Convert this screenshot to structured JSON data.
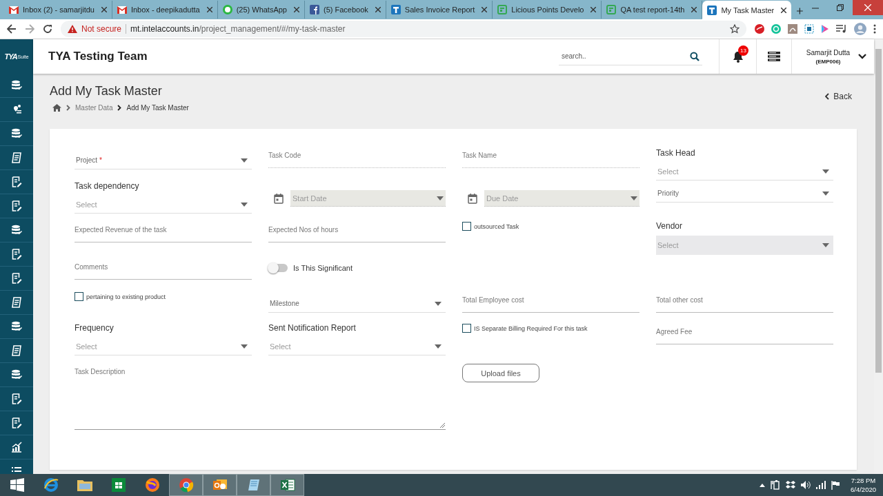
{
  "browser": {
    "tabs": [
      {
        "title": "Inbox (2) - samarjitdu",
        "kind": "mail",
        "selected": false
      },
      {
        "title": "Inbox - deepikadutta",
        "kind": "mail",
        "selected": false
      },
      {
        "title": "(25) WhatsApp",
        "kind": "chat",
        "selected": false
      },
      {
        "title": "(5) Facebook",
        "kind": "social",
        "selected": false
      },
      {
        "title": "Sales Invoice Report",
        "kind": "app",
        "selected": false
      },
      {
        "title": "Licious Points Develo",
        "kind": "sheet",
        "selected": false
      },
      {
        "title": "QA test report-14th",
        "kind": "sheet",
        "selected": false
      },
      {
        "title": "My Task Master",
        "kind": "app",
        "selected": true
      }
    ],
    "security": "Not secure",
    "url_host": "mt.intelaccounts.in",
    "url_path": "/project_management/#/my-task-master"
  },
  "header": {
    "logo": "TYA",
    "logo_sub": "Suite",
    "team": "TYA Testing Team",
    "search": {
      "placeholder": "search.."
    },
    "notifications": "13",
    "user": {
      "name": "Samarjit Dutta",
      "code": "(EMP006)"
    }
  },
  "page": {
    "title": "Add My Task Master",
    "breadcrumb": [
      {
        "label": "Master Data",
        "current": false
      },
      {
        "label": "Add My Task Master",
        "current": true
      }
    ],
    "back": "Back"
  },
  "form": {
    "rows": [
      {
        "fields": [
          {
            "kind": "select",
            "label": "Project",
            "required_mark": "*"
          },
          {
            "kind": "dotted",
            "label": "Task Code"
          },
          {
            "kind": "dotted",
            "label": "Task Name"
          },
          {
            "kind": "labeled-select",
            "label": "Task Head",
            "placeholder": "Select",
            "disabled": false
          }
        ]
      },
      {
        "fields": [
          {
            "kind": "labeled-select",
            "label": "Task dependency",
            "placeholder": "Select",
            "disabled": false
          },
          {
            "kind": "date",
            "label": "Start Date",
            "disabled": true
          },
          {
            "kind": "date",
            "label": "Due Date",
            "disabled": true
          },
          {
            "kind": "select",
            "label": "Priority"
          }
        ]
      },
      {
        "fields": [
          {
            "kind": "text",
            "label": "Expected Revenue of the task"
          },
          {
            "kind": "text",
            "label": "Expected Nos of hours"
          },
          {
            "kind": "checkbox",
            "label": "outsourced Task",
            "checked": false
          },
          {
            "kind": "labeled-select",
            "label": "Vendor",
            "placeholder": "Select",
            "disabled": true
          }
        ]
      },
      {
        "fields": [
          {
            "kind": "text",
            "label": "Comments"
          },
          {
            "kind": "toggle",
            "label": "Is This Significant",
            "on": false
          }
        ]
      },
      {
        "fields": [
          {
            "kind": "checkbox",
            "label": "pertaining to existing product",
            "checked": false
          },
          {
            "kind": "select",
            "label": "Milestone"
          },
          {
            "kind": "text",
            "label": "Total Employee cost"
          },
          {
            "kind": "text",
            "label": "Total other cost"
          }
        ]
      },
      {
        "fields": [
          {
            "kind": "labeled-select",
            "label": "Frequency",
            "placeholder": "Select",
            "disabled": false
          },
          {
            "kind": "labeled-select",
            "label": "Sent Notification Report",
            "placeholder": "Select",
            "disabled": false
          },
          {
            "kind": "checkbox",
            "label": "IS Separate Billing Required For this task",
            "checked": false
          },
          {
            "kind": "text",
            "label": "Agreed Fee"
          }
        ]
      },
      {
        "fields": [
          {
            "kind": "textarea",
            "label": "Task Description"
          },
          {
            "kind": "button",
            "label": "Upload files"
          }
        ]
      }
    ]
  },
  "taskbar": {
    "time": "7:28 PM",
    "date": "6/4/2020"
  }
}
